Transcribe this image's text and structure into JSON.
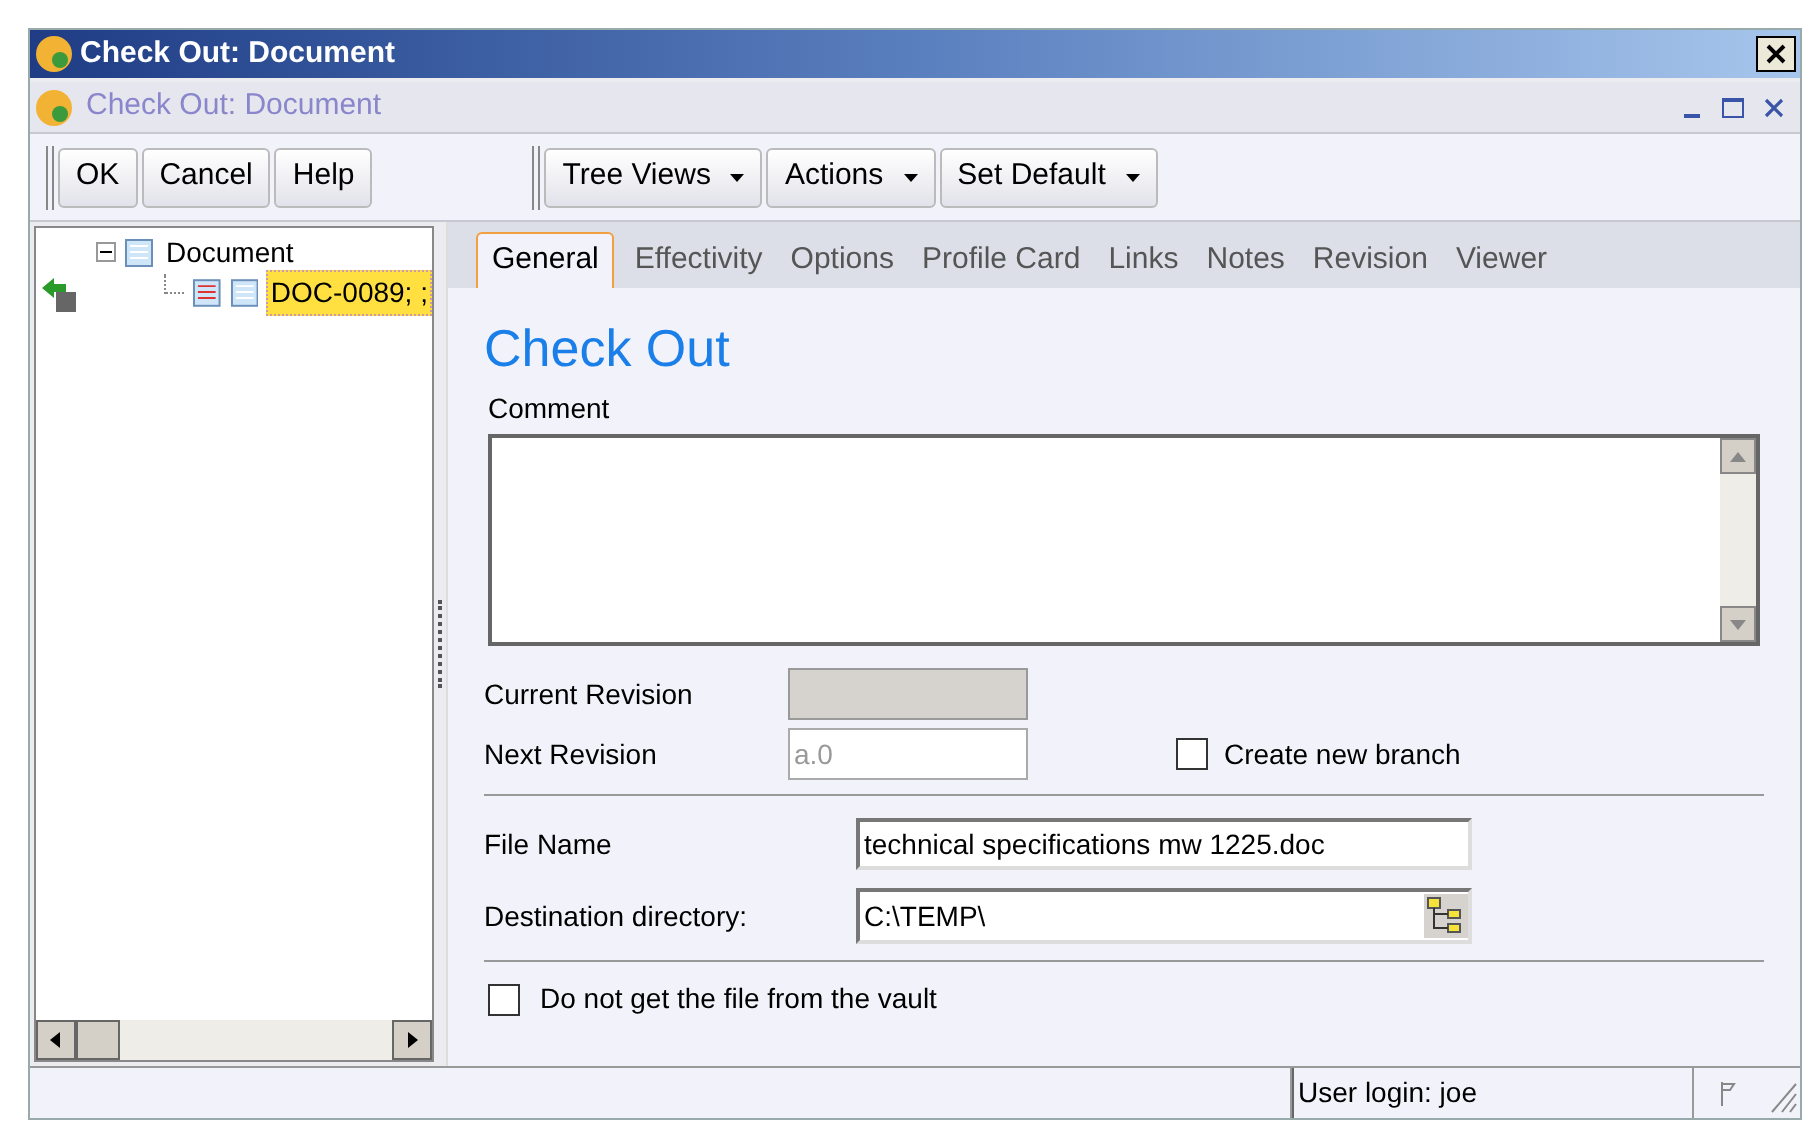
{
  "window": {
    "title": "Check Out: Document"
  },
  "inner_window": {
    "title": "Check Out: Document"
  },
  "toolbar": {
    "buttons": [
      {
        "label": "OK"
      },
      {
        "label": "Cancel"
      },
      {
        "label": "Help"
      }
    ],
    "menus": [
      {
        "label": "Tree Views"
      },
      {
        "label": "Actions"
      },
      {
        "label": "Set Default"
      }
    ]
  },
  "tree": {
    "items": [
      {
        "label": "Document",
        "expanded": true,
        "selected": false,
        "children": [
          {
            "label": "DOC-0089; ;",
            "selected": true
          }
        ]
      }
    ]
  },
  "tabs": [
    {
      "label": "General",
      "selected": true
    },
    {
      "label": "Effectivity",
      "selected": false
    },
    {
      "label": "Options",
      "selected": false
    },
    {
      "label": "Profile Card",
      "selected": false
    },
    {
      "label": "Links",
      "selected": false
    },
    {
      "label": "Notes",
      "selected": false
    },
    {
      "label": "Revision",
      "selected": false
    },
    {
      "label": "Viewer",
      "selected": false
    }
  ],
  "form": {
    "heading": "Check Out",
    "comment_label": "Comment",
    "current_revision": {
      "label": "Current Revision"
    },
    "next_revision": {
      "label": "Next Revision",
      "placeholder": "a.0"
    },
    "create_new_branch": {
      "label": "Create new branch",
      "checked": false
    },
    "file_name": {
      "label": "File Name",
      "value": "technical specifications mw 1225.doc"
    },
    "destination": {
      "label": "Destination directory:",
      "value": "C:\\TEMP\\"
    },
    "do_not_get": {
      "label": "Do not get the file from the vault",
      "checked": false
    }
  },
  "status_bar": {
    "user": "User login: joe"
  }
}
